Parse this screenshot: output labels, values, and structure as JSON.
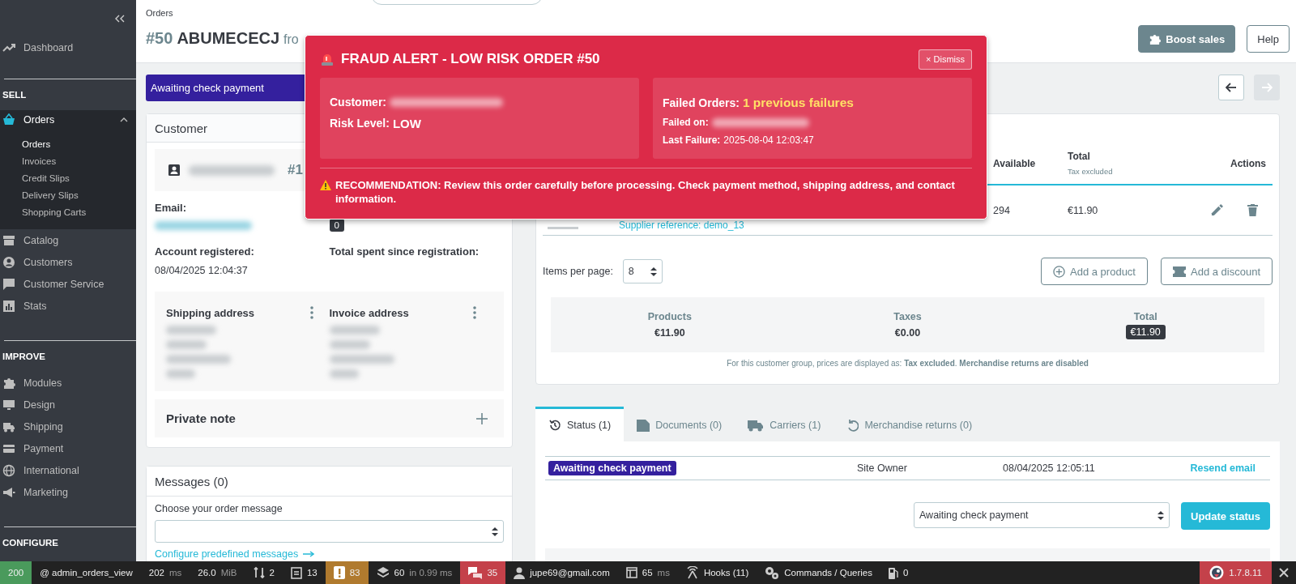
{
  "sidebar": {
    "sections": [
      {
        "items": [
          {
            "label": "Dashboard",
            "selected": false
          }
        ]
      },
      {
        "heading": "SELL",
        "items": [
          {
            "label": "Orders",
            "selected": true,
            "expanded": true,
            "children": [
              {
                "label": "Orders",
                "selected": true
              },
              {
                "label": "Invoices",
                "selected": false
              },
              {
                "label": "Credit Slips",
                "selected": false
              },
              {
                "label": "Delivery Slips",
                "selected": false
              },
              {
                "label": "Shopping Carts",
                "selected": false
              }
            ]
          },
          {
            "label": "Catalog",
            "selected": false
          },
          {
            "label": "Customers",
            "selected": false
          },
          {
            "label": "Customer Service",
            "selected": false
          },
          {
            "label": "Stats",
            "selected": false
          }
        ]
      },
      {
        "heading": "IMPROVE",
        "items": [
          {
            "label": "Modules",
            "selected": false
          },
          {
            "label": "Design",
            "selected": false
          },
          {
            "label": "Shipping",
            "selected": false
          },
          {
            "label": "Payment",
            "selected": false
          },
          {
            "label": "International",
            "selected": false
          },
          {
            "label": "Marketing",
            "selected": false
          }
        ]
      },
      {
        "heading": "CONFIGURE"
      }
    ]
  },
  "header": {
    "breadcrumb": "Orders",
    "order_number": "#50",
    "reference": "ABUMECECJ",
    "from_text": "fro",
    "buttons": [
      "Boost sales",
      "Help"
    ]
  },
  "order_status": {
    "value": "Awaiting check payment"
  },
  "pager": [
    {
      "kind": "previous",
      "disabled": false
    },
    {
      "kind": "next",
      "disabled": true
    }
  ],
  "customer": {
    "title": "Customer",
    "id_prefix": "#1",
    "email_label": "Email:",
    "orders_count": "0",
    "registered_label": "Account registered:",
    "registered": "08/04/2025 12:04:37",
    "total_spent_label": "Total spent since registration:",
    "addresses": [
      {
        "title": "Shipping address"
      },
      {
        "title": "Invoice address"
      }
    ],
    "private_note": "Private note"
  },
  "messages": {
    "title": "Messages (0)",
    "label": "Choose your order message",
    "link": "Configure predefined messages"
  },
  "products": {
    "columns": [
      {
        "label": "Available"
      },
      {
        "label": "Total",
        "sub": "Tax excluded"
      },
      {
        "label": "Actions"
      }
    ],
    "row": {
      "supplier_reference": "Supplier reference: demo_13",
      "available": "294",
      "total": "€11.90"
    },
    "per_page_label": "Items per page:",
    "per_page": "8",
    "buttons": [
      "Add a product",
      "Add a discount"
    ],
    "summary": [
      {
        "label": "Products",
        "value": "€11.90",
        "kind": "plain"
      },
      {
        "label": "Taxes",
        "value": "€0.00",
        "kind": "plain"
      },
      {
        "label": "Total",
        "value": "€11.90",
        "kind": "badge"
      }
    ],
    "note": "For this customer group, prices are displayed as: **Tax excluded**. **Merchandise returns are disabled**"
  },
  "history": {
    "tabs": [
      {
        "label": "Status (1)",
        "selected": true
      },
      {
        "label": "Documents (0)",
        "selected": false
      },
      {
        "label": "Carriers (1)",
        "selected": false
      },
      {
        "label": "Merchandise returns (0)",
        "selected": false
      }
    ],
    "rows": [
      {
        "status": "Awaiting check payment",
        "color": "#34209e",
        "employee": "Site Owner",
        "date": "08/04/2025 12:05:11",
        "action": "Resend email"
      }
    ],
    "status_select": "Awaiting check payment",
    "update_button": "Update status"
  },
  "fraud_alert": {
    "title": "FRAUD ALERT - LOW RISK ORDER #50",
    "dismiss": "× Dismiss",
    "customer_label": "Customer:",
    "risk_label": "Risk Level:",
    "risk": "LOW",
    "failed_orders_label": "Failed Orders:",
    "failed_orders": "1 previous failures",
    "failed_on_label": "Failed on:",
    "last_failure_label": "Last Failure:",
    "last_failure": "2025-08-04 12:03:47",
    "recommendation": "RECOMMENDATION: Review this order carefully before processing. Check payment method, shipping address, and contact information."
  },
  "debug_bar": {
    "items": [
      {
        "value": "200",
        "color": "#4a9a5c"
      },
      {
        "value": "@ admin_orders_view"
      },
      {
        "value": "202",
        "unit": "ms"
      },
      {
        "value": "26.0",
        "unit": "MiB"
      },
      {
        "value": "2"
      },
      {
        "value": "13"
      },
      {
        "value": "83",
        "color": "#b07a2e"
      },
      {
        "value": "60",
        "unit": "in 0.99 ms"
      },
      {
        "value": "35",
        "color": "#c4414a"
      },
      {
        "value": "jupe69@gmail.com"
      },
      {
        "value": "65",
        "unit": "ms"
      },
      {
        "value": "Hooks (11)"
      },
      {
        "value": "Commands / Queries"
      },
      {
        "value": "0"
      }
    ],
    "version": "1.7.8.11"
  }
}
